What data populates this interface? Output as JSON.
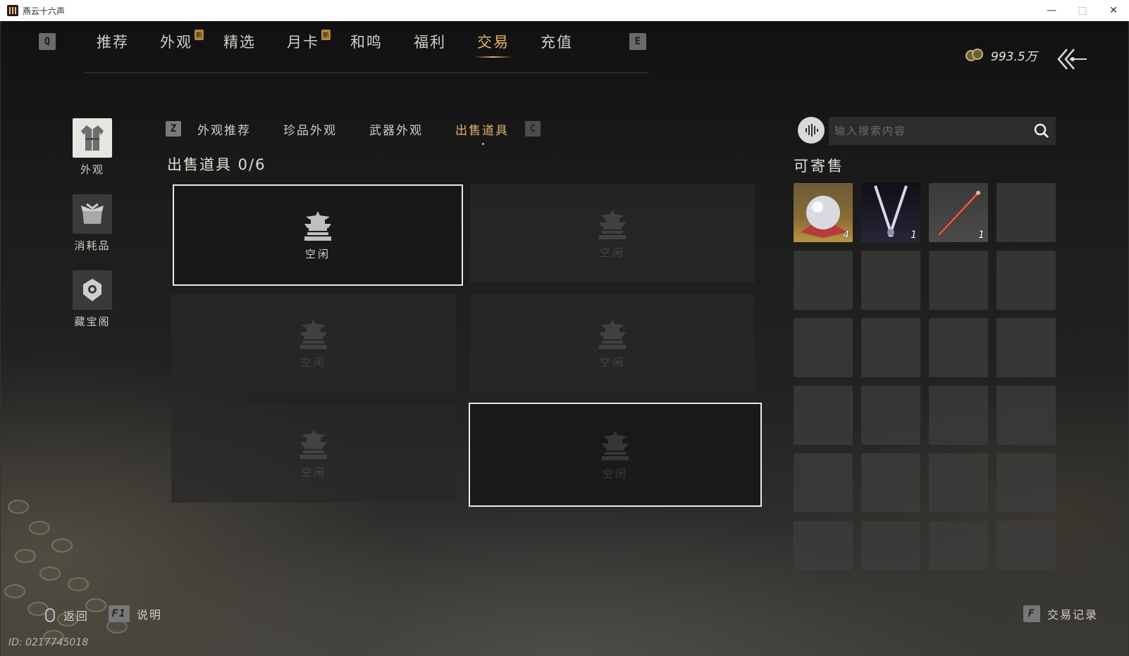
{
  "window": {
    "title": "燕云十六声"
  },
  "top_nav": {
    "left_key": "Q",
    "right_key": "E",
    "tabs": [
      {
        "label": "推荐",
        "badge": ""
      },
      {
        "label": "外观",
        "badge": "新"
      },
      {
        "label": "精选",
        "badge": ""
      },
      {
        "label": "月卡",
        "badge": "新"
      },
      {
        "label": "和鸣",
        "badge": ""
      },
      {
        "label": "福利",
        "badge": ""
      },
      {
        "label": "交易",
        "badge": "",
        "active": true
      },
      {
        "label": "充值",
        "badge": ""
      }
    ]
  },
  "currency": {
    "amount": "993.5万",
    "icon": "coin-purse-icon"
  },
  "side_categories": [
    {
      "label": "外观",
      "icon": "robe-icon",
      "active": true
    },
    {
      "label": "消耗品",
      "icon": "package-icon"
    },
    {
      "label": "藏宝阁",
      "icon": "treasure-pavilion-icon"
    }
  ],
  "sub_nav": {
    "left_key": "Z",
    "right_key": "C",
    "tabs": [
      {
        "label": "外观推荐"
      },
      {
        "label": "珍品外观"
      },
      {
        "label": "武器外观"
      },
      {
        "label": "出售道具",
        "active": true
      }
    ]
  },
  "sell_section": {
    "title": "出售道具 0/6",
    "slots": [
      {
        "label": "空闲",
        "state": "selected"
      },
      {
        "label": "空闲",
        "state": "empty"
      },
      {
        "label": "空闲",
        "state": "empty"
      },
      {
        "label": "空闲",
        "state": "empty"
      },
      {
        "label": "空闲",
        "state": "empty"
      },
      {
        "label": "空闲",
        "state": "hover"
      }
    ]
  },
  "search": {
    "placeholder": "输入搜索内容"
  },
  "sellable": {
    "title": "可寄售",
    "items": [
      {
        "name": "pearl-item",
        "count": "4"
      },
      {
        "name": "twin-blades-item",
        "count": "1"
      },
      {
        "name": "flute-item",
        "count": "1"
      }
    ]
  },
  "footer": {
    "back_label": "返回",
    "help_key": "F1",
    "help_label": "说明",
    "record_key": "F",
    "record_label": "交易记录",
    "player_id": "ID: 0217745018"
  },
  "colors": {
    "accent": "#e3b46a",
    "slot_outline": "#e9e9e9"
  }
}
